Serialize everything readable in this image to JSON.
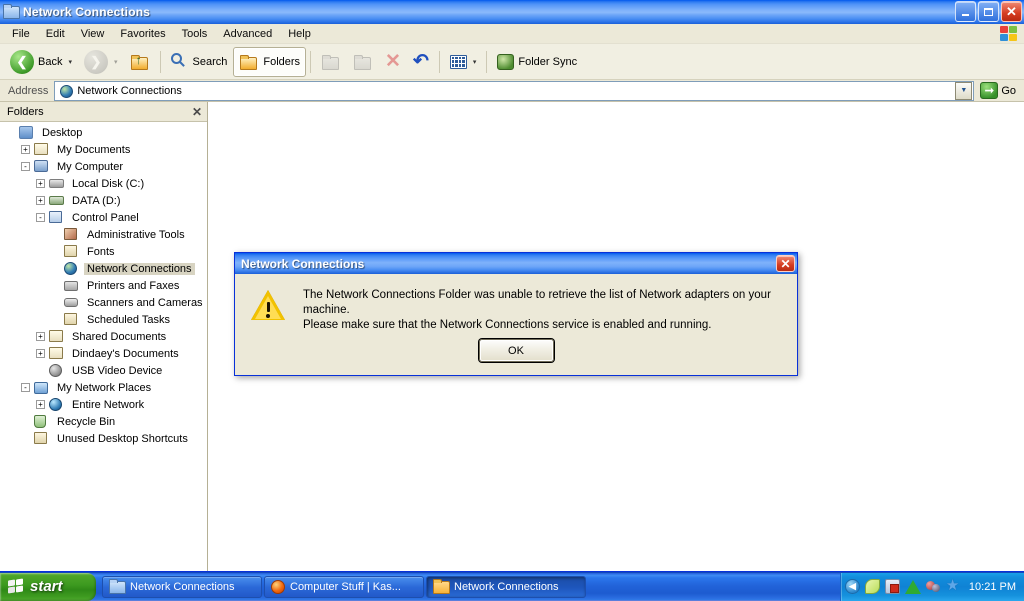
{
  "window": {
    "title": "Network Connections",
    "icon": "folder-network-icon",
    "buttons": {
      "minimize": "_",
      "maximize": "❐",
      "close": "✕"
    }
  },
  "menu": {
    "items": [
      {
        "label": "File"
      },
      {
        "label": "Edit"
      },
      {
        "label": "View"
      },
      {
        "label": "Favorites"
      },
      {
        "label": "Tools"
      },
      {
        "label": "Advanced"
      },
      {
        "label": "Help"
      }
    ],
    "right_icon": "windows-flag-icon"
  },
  "toolbar": {
    "back_label": "Back",
    "back_icon": "back-arrow-icon",
    "back_caret": "▾",
    "forward_icon": "forward-arrow-icon",
    "forward_caret": "▾",
    "up_icon": "up-folder-icon",
    "search_label": "Search",
    "search_icon": "magnifier-icon",
    "folders_label": "Folders",
    "folders_icon": "folder-open-icon",
    "move_to_icon": "move-to-folder-icon",
    "copy_to_icon": "copy-to-folder-icon",
    "delete_icon": "delete-x-icon",
    "undo_icon": "undo-arrow-icon",
    "views_icon": "views-grid-icon",
    "views_caret": "▾",
    "folder_sync_label": "Folder Sync",
    "folder_sync_icon": "folder-sync-icon"
  },
  "address": {
    "label": "Address",
    "value": "Network Connections",
    "icon": "network-globe-icon",
    "dropdown_caret": "▼",
    "go_label": "Go",
    "go_icon": "go-arrow-icon"
  },
  "folders_pane": {
    "title": "Folders",
    "close_label": "✕",
    "tree": [
      {
        "label": "Desktop",
        "indent": 0,
        "expander": "",
        "icon": "desktop-icon",
        "selected": false
      },
      {
        "label": "My Documents",
        "indent": 1,
        "expander": "+",
        "icon": "my-documents-icon",
        "selected": false
      },
      {
        "label": "My Computer",
        "indent": 1,
        "expander": "-",
        "icon": "my-computer-icon",
        "selected": false
      },
      {
        "label": "Local Disk (C:)",
        "indent": 2,
        "expander": "+",
        "icon": "hard-disk-icon",
        "selected": false
      },
      {
        "label": "DATA (D:)",
        "indent": 2,
        "expander": "+",
        "icon": "data-drive-icon",
        "selected": false
      },
      {
        "label": "Control Panel",
        "indent": 2,
        "expander": "-",
        "icon": "control-panel-icon",
        "selected": false
      },
      {
        "label": "Administrative Tools",
        "indent": 3,
        "expander": "",
        "icon": "administrative-tools-icon",
        "selected": false
      },
      {
        "label": "Fonts",
        "indent": 3,
        "expander": "",
        "icon": "fonts-folder-icon",
        "selected": false
      },
      {
        "label": "Network Connections",
        "indent": 3,
        "expander": "",
        "icon": "network-connections-icon",
        "selected": true
      },
      {
        "label": "Printers and Faxes",
        "indent": 3,
        "expander": "",
        "icon": "printer-icon",
        "selected": false
      },
      {
        "label": "Scanners and Cameras",
        "indent": 3,
        "expander": "",
        "icon": "scanner-icon",
        "selected": false
      },
      {
        "label": "Scheduled Tasks",
        "indent": 3,
        "expander": "",
        "icon": "scheduled-tasks-icon",
        "selected": false
      },
      {
        "label": "Shared Documents",
        "indent": 2,
        "expander": "+",
        "icon": "shared-documents-icon",
        "selected": false
      },
      {
        "label": "Dindaey's Documents",
        "indent": 2,
        "expander": "+",
        "icon": "user-documents-icon",
        "selected": false
      },
      {
        "label": "USB Video Device",
        "indent": 2,
        "expander": "",
        "icon": "usb-video-device-icon",
        "selected": false
      },
      {
        "label": "My Network Places",
        "indent": 1,
        "expander": "-",
        "icon": "my-network-places-icon",
        "selected": false
      },
      {
        "label": "Entire Network",
        "indent": 2,
        "expander": "+",
        "icon": "entire-network-icon",
        "selected": false
      },
      {
        "label": "Recycle Bin",
        "indent": 1,
        "expander": "",
        "icon": "recycle-bin-icon",
        "selected": false
      },
      {
        "label": "Unused Desktop Shortcuts",
        "indent": 1,
        "expander": "",
        "icon": "folder-icon",
        "selected": false
      }
    ]
  },
  "dialog": {
    "title": "Network Connections",
    "close_label": "✕",
    "icon": "warning-triangle-icon",
    "message_line1": "The Network Connections Folder was unable to retrieve the list of Network adapters on your machine.",
    "message_line2": "Please make sure that the Network Connections service is enabled and running.",
    "ok_label": "OK"
  },
  "taskbar": {
    "start_label": "start",
    "start_icon": "windows-flag-icon",
    "tasks": [
      {
        "label": "Network Connections",
        "icon": "folder-network-icon",
        "active": false
      },
      {
        "label": "Computer Stuff | Kas...",
        "icon": "firefox-icon",
        "active": false
      },
      {
        "label": "Network Connections",
        "icon": "folder-icon",
        "active": true
      }
    ],
    "tray": {
      "chevron_label": "◀",
      "icons": [
        {
          "name": "leaf-tray-icon"
        },
        {
          "name": "internet-explorer-tray-icon"
        },
        {
          "name": "green-triangle-tray-icon"
        },
        {
          "name": "audio-devices-tray-icon"
        },
        {
          "name": "star-tray-icon",
          "glyph": "★"
        }
      ],
      "clock": "10:21 PM"
    }
  },
  "colors": {
    "title_blue": "#0058ee",
    "desktop_blue": "#5a7edc",
    "taskbar_blue": "#245edb",
    "start_green": "#3d9a20",
    "dialog_face": "#ece9d8",
    "selection": "#d8d4c2",
    "warning_yellow": "#f2c200"
  }
}
